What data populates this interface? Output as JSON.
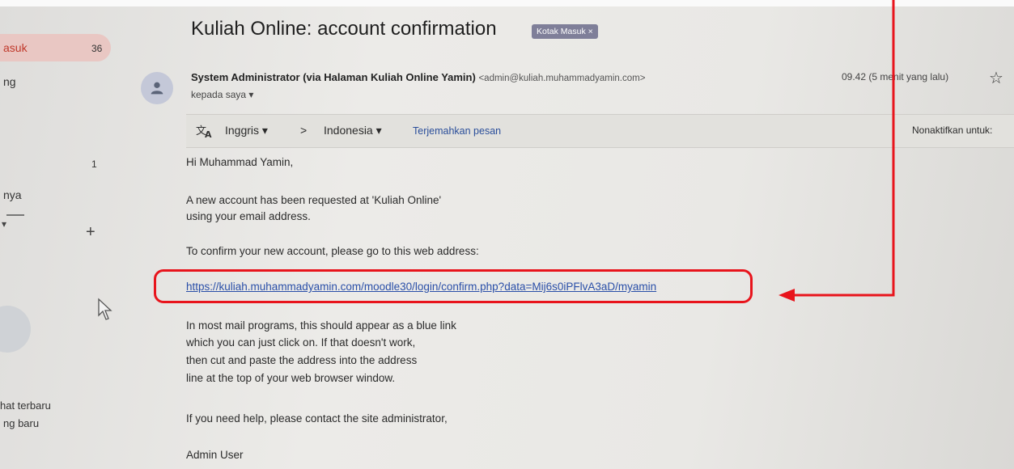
{
  "sidebar": {
    "items": [
      {
        "label": "asuk",
        "count": "36"
      },
      {
        "label": "ng"
      },
      {
        "label": "",
        "count": "1"
      },
      {
        "label": "nya"
      },
      {
        "label": "hat terbaru"
      },
      {
        "label": "ng baru"
      }
    ]
  },
  "email": {
    "subject": "Kuliah Online: account confirmation",
    "label_chip": "Kotak Masuk ×",
    "sender_name": "System Administrator (via Halaman Kuliah Online Yamin)",
    "sender_email": "<admin@kuliah.muhammadyamin.com>",
    "recipient": "kepada saya ▾",
    "time": "09.42 (5 menit yang lalu)"
  },
  "translate": {
    "from_lang": "Inggris ▾",
    "separator": ">",
    "to_lang": "Indonesia ▾",
    "translate_link": "Terjemahkan pesan",
    "disable_label": "Nonaktifkan untuk:"
  },
  "body": {
    "greeting": "Hi Muhammad Yamin,",
    "line1": "A new account has been requested at 'Kuliah Online'",
    "line2": "using your email address.",
    "line3": "To confirm your new account, please go to this web address:",
    "link": "https://kuliah.muhammadyamin.com/moodle30/login/confirm.php?data=Mij6s0iPFlvA3aD/myamin",
    "line4": "In most mail programs, this should appear as a blue link",
    "line5": "which you can just click on. If that doesn't work,",
    "line6": "then cut and paste the address into the address",
    "line7": "line at the top of your web browser window.",
    "line8": "If you need help, please contact the site administrator,",
    "signature": "Admin User"
  },
  "colors": {
    "highlight": "#e8141c",
    "link": "#2a4fa8",
    "label_chip": "#7f7f99"
  }
}
